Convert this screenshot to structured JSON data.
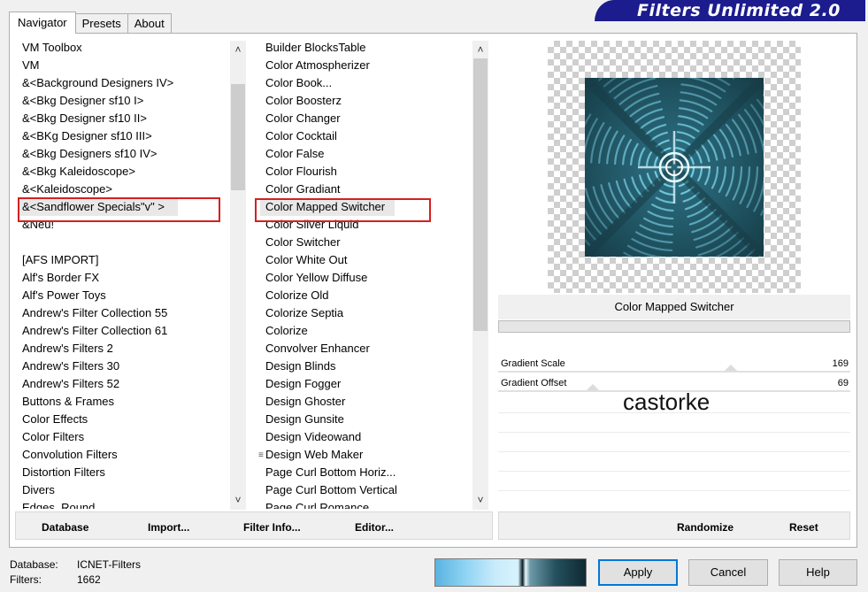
{
  "tabs": [
    "Navigator",
    "Presets",
    "About"
  ],
  "brand_title": "Filters Unlimited 2.0",
  "categories": [
    "VM Toolbox",
    "VM",
    "&<Background Designers IV>",
    "&<Bkg Designer sf10 I>",
    "&<Bkg Designer sf10 II>",
    "&<BKg Designer sf10 III>",
    "&<Bkg Designers sf10 IV>",
    "&<Bkg Kaleidoscope>",
    "&<Kaleidoscope>",
    "&<Sandflower Specials\"v\" >",
    "&Neu!",
    "",
    "[AFS IMPORT]",
    "Alf's Border FX",
    "Alf's Power Toys",
    "Andrew's Filter Collection 55",
    "Andrew's Filter Collection 61",
    "Andrew's Filters 2",
    "Andrew's Filters 30",
    "Andrew's Filters 52",
    "Buttons & Frames",
    "Color Effects",
    "Color Filters",
    "Convolution Filters",
    "Distortion Filters",
    "Divers",
    "Edges, Round"
  ],
  "filters": [
    "Builder BlocksTable",
    "Color Atmospherizer",
    "Color Book...",
    "Color Boosterz",
    "Color Changer",
    "Color Cocktail",
    "Color False",
    "Color Flourish",
    "Color Gradiant",
    "Color Mapped Switcher",
    "Color Silver Liquid",
    "Color Switcher",
    "Color White Out",
    "Color Yellow Diffuse",
    "Colorize Old",
    "Colorize Septia",
    "Colorize",
    "Convolver Enhancer",
    "Design Blinds",
    "Design Fogger",
    "Design Ghoster",
    "Design Gunsite",
    "Design Videowand",
    "Design Web Maker",
    "Page Curl Bottom Horiz...",
    "Page Curl Bottom Vertical",
    "Page Curl Romance"
  ],
  "toolbar_left": {
    "database": "Database",
    "import": "Import...",
    "filter_info": "Filter Info...",
    "editor": "Editor..."
  },
  "toolbar_right": {
    "randomize": "Randomize",
    "reset": "Reset"
  },
  "selected_filter": "Color Mapped Switcher",
  "params": [
    {
      "label": "Gradient Scale",
      "value": "169"
    },
    {
      "label": "Gradient Offset",
      "value": "69"
    }
  ],
  "watermark": "castorke",
  "status": {
    "database_label": "Database:",
    "database_value": "ICNET-Filters",
    "filters_label": "Filters:",
    "filters_value": "1662"
  },
  "buttons": {
    "apply": "Apply",
    "cancel": "Cancel",
    "help": "Help"
  },
  "colors": {
    "brand_bg": "#1c1c8e",
    "selection_border": "#d42020",
    "preview_base": "#1e4f5c",
    "default_button_border": "#0078d7"
  }
}
